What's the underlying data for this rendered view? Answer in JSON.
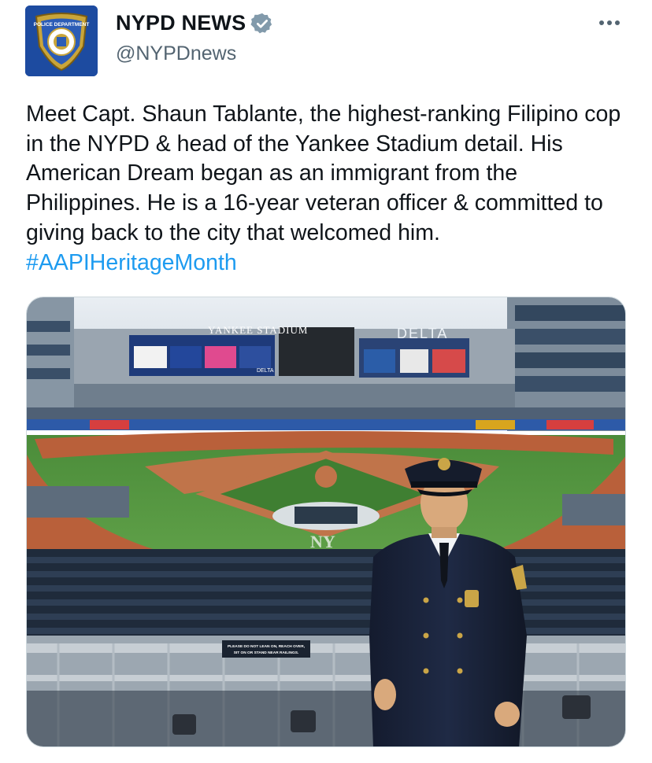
{
  "account": {
    "display_name": "NYPD NEWS",
    "handle": "@NYPDnews",
    "verified": true,
    "avatar_text_top": "POLICE DEPARTMENT",
    "avatar_text_ring": "CITY OF NEW YORK"
  },
  "tweet": {
    "text": "Meet Capt. Shaun Tablante, the highest-ranking Filipino cop in the NYPD & head of the Yankee Stadium detail. His American Dream began as an immigrant from the Philippines. He is a 16-year veteran officer & committed to giving back to the city that welcomed him. ",
    "hashtag": "#AAPIHeritageMonth"
  },
  "media": {
    "stadium_sign": "YANKEE STADIUM",
    "delta_sign": "DELTA",
    "ad_delta_small": "DELTA",
    "railing_sign_line1": "PLEASE DO NOT LEAN ON, REACH OVER,",
    "railing_sign_line2": "SIT ON OR STAND NEAR RAILINGS."
  },
  "icons": {
    "verified": "verified-badge-icon",
    "more": "more-options-icon"
  },
  "colors": {
    "text": "#0f1419",
    "secondary": "#536471",
    "link": "#1d9bf0",
    "avatar_bg": "#1d4ba0"
  }
}
